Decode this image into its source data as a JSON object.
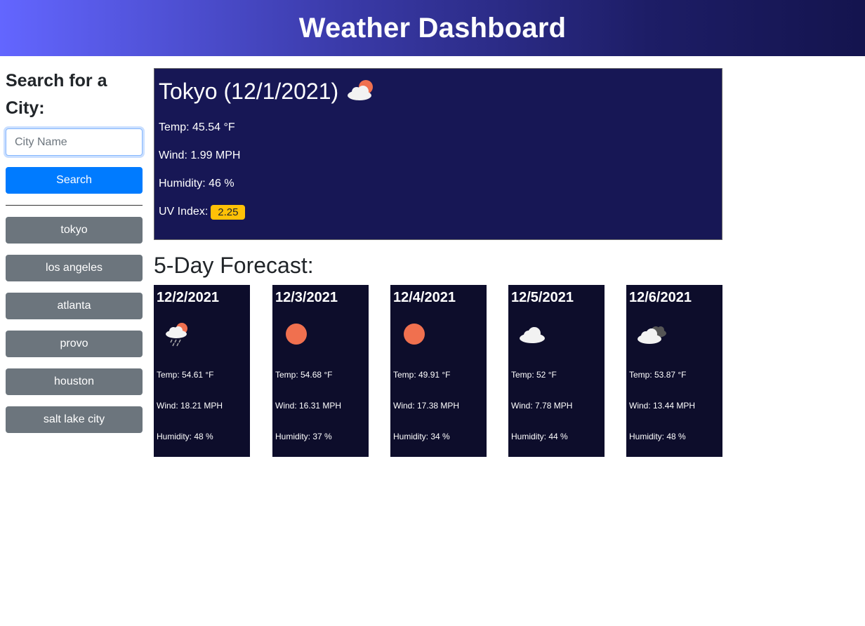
{
  "header": {
    "title": "Weather Dashboard"
  },
  "sidebar": {
    "heading": "Search for a City:",
    "input_placeholder": "City Name",
    "search_label": "Search",
    "history": [
      "tokyo",
      "los angeles",
      "atlanta",
      "provo",
      "houston",
      "salt lake city"
    ]
  },
  "current": {
    "title": "Tokyo (12/1/2021)",
    "icon": "partly-cloudy-day-icon",
    "temp": "Temp: 45.54 °F",
    "wind": "Wind: 1.99 MPH",
    "humidity": "Humidity: 46 %",
    "uv_label": "UV Index:",
    "uv_value": "2.25"
  },
  "forecast": {
    "title": "5-Day Forecast:",
    "days": [
      {
        "date": "12/2/2021",
        "icon": "rain-partly-cloudy-icon",
        "temp": "Temp: 54.61 °F",
        "wind": "Wind: 18.21 MPH",
        "humidity": "Humidity: 48 %"
      },
      {
        "date": "12/3/2021",
        "icon": "sun-icon",
        "temp": "Temp: 54.68 °F",
        "wind": "Wind: 16.31 MPH",
        "humidity": "Humidity: 37 %"
      },
      {
        "date": "12/4/2021",
        "icon": "sun-icon",
        "temp": "Temp: 49.91 °F",
        "wind": "Wind: 17.38 MPH",
        "humidity": "Humidity: 34 %"
      },
      {
        "date": "12/5/2021",
        "icon": "cloud-icon",
        "temp": "Temp: 52 °F",
        "wind": "Wind: 7.78 MPH",
        "humidity": "Humidity: 44 %"
      },
      {
        "date": "12/6/2021",
        "icon": "broken-clouds-icon",
        "temp": "Temp: 53.87 °F",
        "wind": "Wind: 13.44 MPH",
        "humidity": "Humidity: 48 %"
      }
    ]
  },
  "colors": {
    "header_start": "#6366ff",
    "header_end": "#14144e",
    "current_bg": "#171755",
    "forecast_bg": "#0d0d2b",
    "search_button": "#007bff",
    "history_button": "#6c757d",
    "uv_badge": "#ffc107",
    "sun": "#f0704f"
  }
}
